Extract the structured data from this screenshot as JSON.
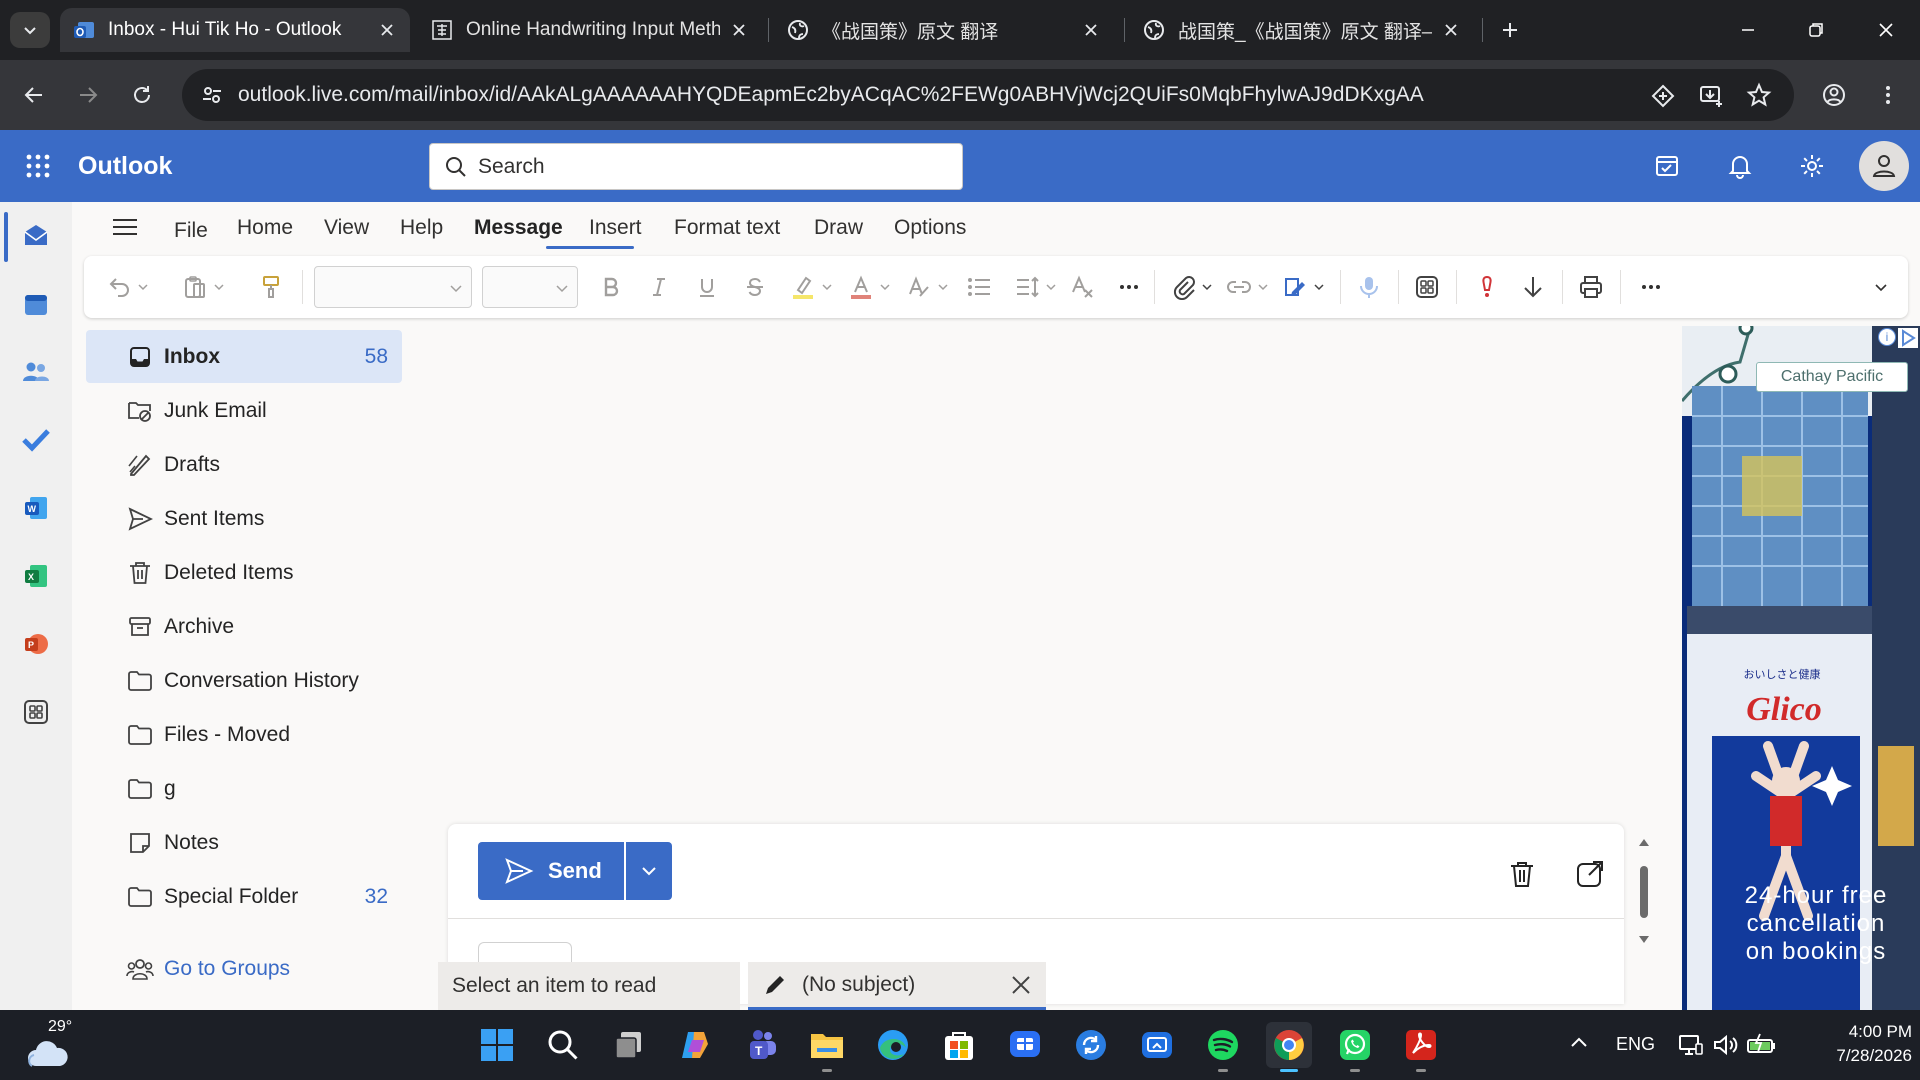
{
  "browser": {
    "tabs": [
      {
        "title": "Inbox - Hui Tik Ho - Outlook",
        "active": true,
        "icon": "outlook-icon"
      },
      {
        "title": "Online Handwriting Input Meth",
        "active": false,
        "icon": "handwriting-icon"
      },
      {
        "title": "《战国策》原文 翻译",
        "active": false,
        "icon": "globe-icon"
      },
      {
        "title": "战国策_《战国策》原文 翻译—",
        "active": false,
        "icon": "globe-icon"
      }
    ],
    "url": "outlook.live.com/mail/inbox/id/AAkALgAAAAAAHYQDEapmEc2byACqAC%2FEWg0ABHVjWcj2QUiFs0MqbFhylwAJ9dDKxgAA"
  },
  "header": {
    "app_name": "Outlook",
    "search_placeholder": "Search"
  },
  "ribbon": {
    "menu": [
      "File",
      "Home",
      "View",
      "Help",
      "Message",
      "Insert",
      "Format text",
      "Draw",
      "Options"
    ],
    "active_menu": "Message"
  },
  "folders": [
    {
      "name": "Inbox",
      "count": "58",
      "icon": "inbox-icon",
      "selected": true
    },
    {
      "name": "Junk Email",
      "count": "",
      "icon": "junk-icon"
    },
    {
      "name": "Drafts",
      "count": "",
      "icon": "drafts-icon"
    },
    {
      "name": "Sent Items",
      "count": "",
      "icon": "send-icon"
    },
    {
      "name": "Deleted Items",
      "count": "",
      "icon": "trash-icon"
    },
    {
      "name": "Archive",
      "count": "",
      "icon": "archive-icon"
    },
    {
      "name": "Conversation History",
      "count": "",
      "icon": "folder-icon"
    },
    {
      "name": "Files - Moved",
      "count": "",
      "icon": "folder-icon"
    },
    {
      "name": "g",
      "count": "",
      "icon": "folder-icon"
    },
    {
      "name": "Notes",
      "count": "",
      "icon": "note-icon"
    },
    {
      "name": "Special Folder",
      "count": "32",
      "icon": "folder-icon"
    }
  ],
  "groups_link": "Go to Groups",
  "compose": {
    "send_label": "Send"
  },
  "item_tabs": {
    "reading": "Select an item to read",
    "draft": "(No subject)"
  },
  "ad": {
    "brand": "Cathay Pacific",
    "text": "24-hour free\ncancellation\non bookings"
  },
  "taskbar": {
    "temperature": "29°",
    "language": "ENG",
    "time": "4:00 PM",
    "date": "7/28/2026"
  },
  "colors": {
    "outlook_blue": "#3a6bc6",
    "selected_folder": "#dce6f7",
    "chrome_dark": "#202124"
  }
}
